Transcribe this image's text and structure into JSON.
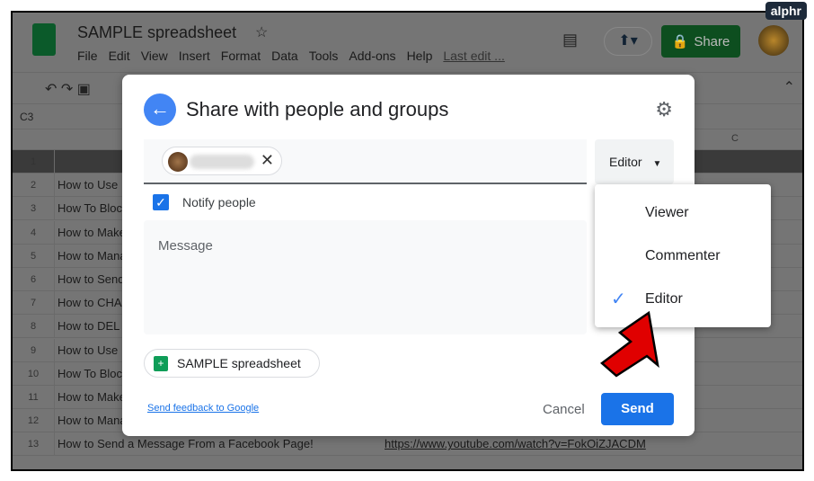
{
  "watermark": "alphr",
  "doc": {
    "title": "SAMPLE spreadsheet",
    "menu": [
      "File",
      "Edit",
      "View",
      "Insert",
      "Format",
      "Data",
      "Tools",
      "Add-ons",
      "Help",
      "Last edit ..."
    ],
    "share_label": "Share",
    "cell_ref": "C3",
    "col_c": "C"
  },
  "rows": [
    {
      "n": "1",
      "a": "",
      "b": ""
    },
    {
      "n": "2",
      "a": "How to Use",
      "b": ""
    },
    {
      "n": "3",
      "a": "How To Bloc",
      "b": ""
    },
    {
      "n": "4",
      "a": "How to Make",
      "b": ""
    },
    {
      "n": "5",
      "a": "How to Mana",
      "b": ""
    },
    {
      "n": "6",
      "a": "How to Send",
      "b": ""
    },
    {
      "n": "7",
      "a": "How to CHA",
      "b": ""
    },
    {
      "n": "8",
      "a": "How to DEL",
      "b": ""
    },
    {
      "n": "9",
      "a": "How to Use",
      "b": ""
    },
    {
      "n": "10",
      "a": "How To Bloc",
      "b": ""
    },
    {
      "n": "11",
      "a": "How to Make",
      "b": ""
    },
    {
      "n": "12",
      "a": "How to Mana",
      "b": ""
    },
    {
      "n": "13",
      "a": "How to Send a Message From a Facebook Page!",
      "b": "https://www.youtube.com/watch?v=FokOiZJACDM"
    }
  ],
  "dialog": {
    "title": "Share with people and groups",
    "role": "Editor",
    "notify": "Notify people",
    "message_placeholder": "Message",
    "file_chip": "SAMPLE spreadsheet",
    "feedback": "Send feedback to Google",
    "cancel": "Cancel",
    "send": "Send"
  },
  "role_menu": [
    {
      "label": "Viewer",
      "checked": false
    },
    {
      "label": "Commenter",
      "checked": false
    },
    {
      "label": "Editor",
      "checked": true
    }
  ],
  "colors": {
    "accent": "#1a73e8",
    "sheets_green": "#0f9d58",
    "arrow": "#e00000"
  }
}
